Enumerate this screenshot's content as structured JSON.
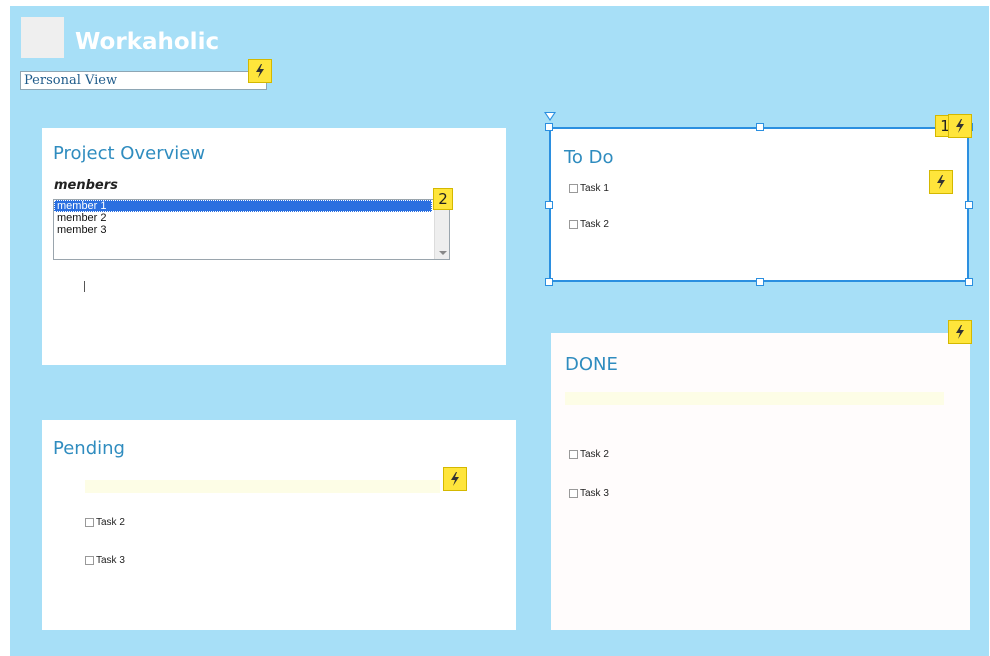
{
  "app": {
    "title": "Workaholic"
  },
  "view_selector": {
    "value": "Personal View"
  },
  "project_overview": {
    "title": "Project Overview",
    "members_label": "menbers",
    "members": [
      "member 1",
      "member 2",
      "member 3"
    ],
    "selected_member": "member 1",
    "badge": "2"
  },
  "todo": {
    "title": "To Do",
    "badge": "1",
    "tasks": [
      "Task 1",
      "Task 2"
    ]
  },
  "done": {
    "title": "DONE",
    "tasks": [
      "Task 2",
      "Task 3"
    ]
  },
  "pending": {
    "title": "Pending",
    "tasks": [
      "Task 2",
      "Task 3"
    ]
  },
  "icons": {
    "action": "lightning-bolt-icon",
    "checkbox": "checkbox-icon"
  },
  "colors": {
    "canvas_background": "#a7dff7",
    "panel_title": "#2f8cbf",
    "action_badge": "#ffe53b",
    "selection": "#2b8fe0",
    "list_selection": "#2a6fe0"
  }
}
